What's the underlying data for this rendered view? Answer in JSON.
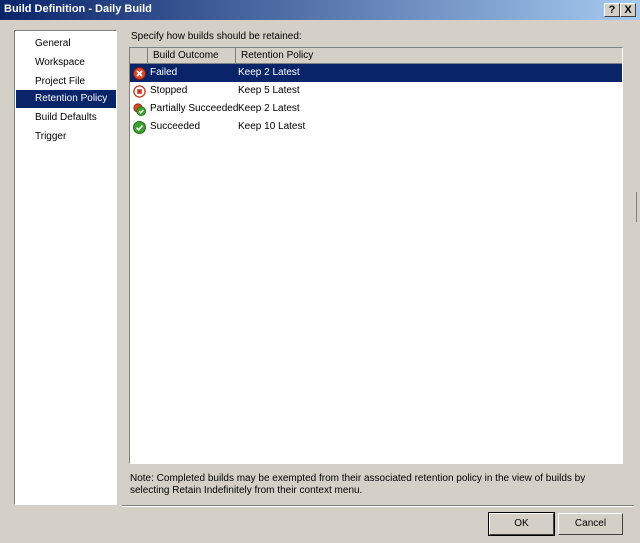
{
  "window": {
    "title": "Build Definition - Daily Build",
    "help_label": "?",
    "close_label": "X"
  },
  "nav": {
    "items": [
      {
        "label": "General",
        "selected": false
      },
      {
        "label": "Workspace",
        "selected": false
      },
      {
        "label": "Project File",
        "selected": false
      },
      {
        "label": "Retention Policy",
        "selected": true
      },
      {
        "label": "Build Defaults",
        "selected": false
      },
      {
        "label": "Trigger",
        "selected": false
      }
    ]
  },
  "main": {
    "prompt": "Specify how builds should be retained:",
    "columns": [
      "",
      "Build Outcome",
      "Retention Policy"
    ],
    "rows": [
      {
        "outcome": "Failed",
        "policy": "Keep 2 Latest",
        "icon": "failed-icon",
        "selected": true
      },
      {
        "outcome": "Stopped",
        "policy": "Keep 5 Latest",
        "icon": "stopped-icon",
        "selected": false
      },
      {
        "outcome": "Partially Succeeded",
        "policy": "Keep 2 Latest",
        "icon": "partially-succeeded-icon",
        "selected": false
      },
      {
        "outcome": "Succeeded",
        "policy": "Keep 10 Latest",
        "icon": "succeeded-icon",
        "selected": false
      }
    ],
    "note": "Note: Completed builds may be exempted from their associated retention policy in the view of builds by selecting Retain Indefinitely from their context menu."
  },
  "buttons": {
    "ok": "OK",
    "cancel": "Cancel"
  },
  "colors": {
    "selection": "#0a246a",
    "dialog_bg": "#d4d0c8"
  }
}
